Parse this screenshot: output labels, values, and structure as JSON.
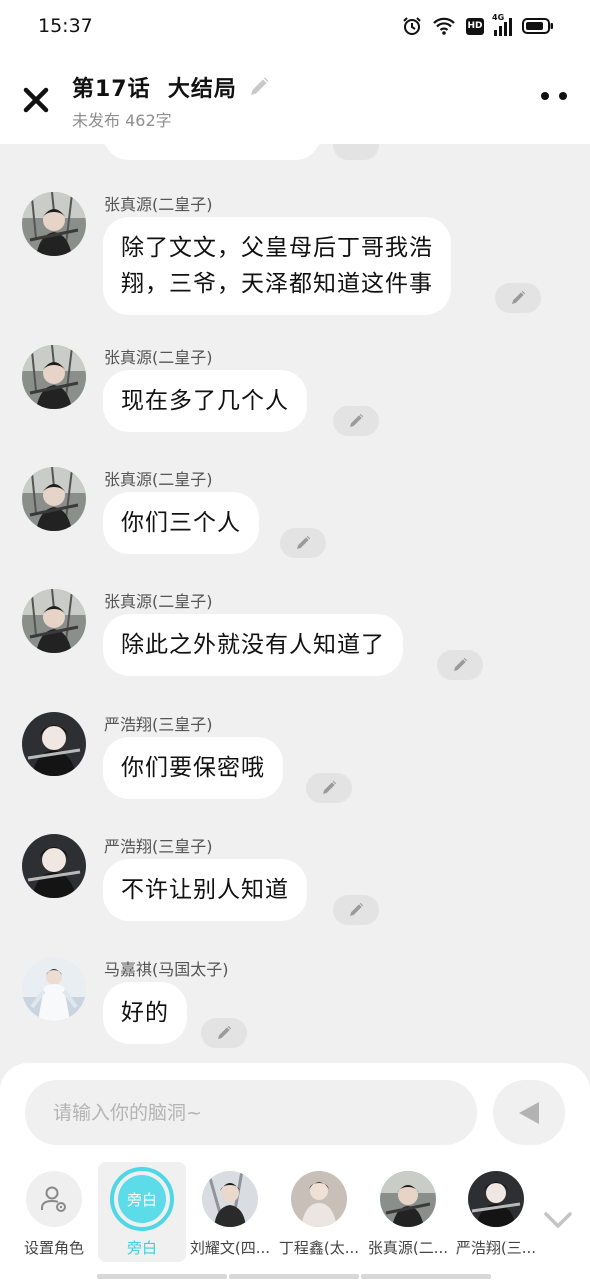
{
  "status_bar": {
    "time": "15:37",
    "network": "4G",
    "hd": "HD"
  },
  "header": {
    "title": "第17话  大结局",
    "subtitle": "未发布 462字"
  },
  "messages": [
    {
      "sender": "张真源(二皇子)",
      "lines": [
        "除了文文，父皇母后丁哥我浩",
        "翔，三爷，天泽都知道这件事"
      ],
      "avatar": "zhang"
    },
    {
      "sender": "张真源(二皇子)",
      "lines": [
        "现在多了几个人"
      ],
      "avatar": "zhang"
    },
    {
      "sender": "张真源(二皇子)",
      "lines": [
        "你们三个人"
      ],
      "avatar": "zhang"
    },
    {
      "sender": "张真源(二皇子)",
      "lines": [
        "除此之外就没有人知道了"
      ],
      "avatar": "zhang"
    },
    {
      "sender": "严浩翔(三皇子)",
      "lines": [
        "你们要保密哦"
      ],
      "avatar": "yan"
    },
    {
      "sender": "严浩翔(三皇子)",
      "lines": [
        "不许让别人知道"
      ],
      "avatar": "yan"
    },
    {
      "sender": "马嘉祺(马国太子)",
      "lines": [
        "好的"
      ],
      "avatar": "ma"
    }
  ],
  "input": {
    "placeholder": "请输入你的脑洞~"
  },
  "characters": [
    {
      "label": "设置角色",
      "type": "setting"
    },
    {
      "label": "旁白",
      "type": "narrator",
      "badge": "旁白",
      "selected": true
    },
    {
      "label": "刘耀文(四...",
      "type": "avatar"
    },
    {
      "label": "丁程鑫(太...",
      "type": "avatar"
    },
    {
      "label": "张真源(二...",
      "type": "avatar"
    },
    {
      "label": "严浩翔(三...",
      "type": "avatar"
    }
  ],
  "colors": {
    "accent": "#4ed7e4",
    "background": "#f0f0f0",
    "bubble": "#ffffff"
  }
}
